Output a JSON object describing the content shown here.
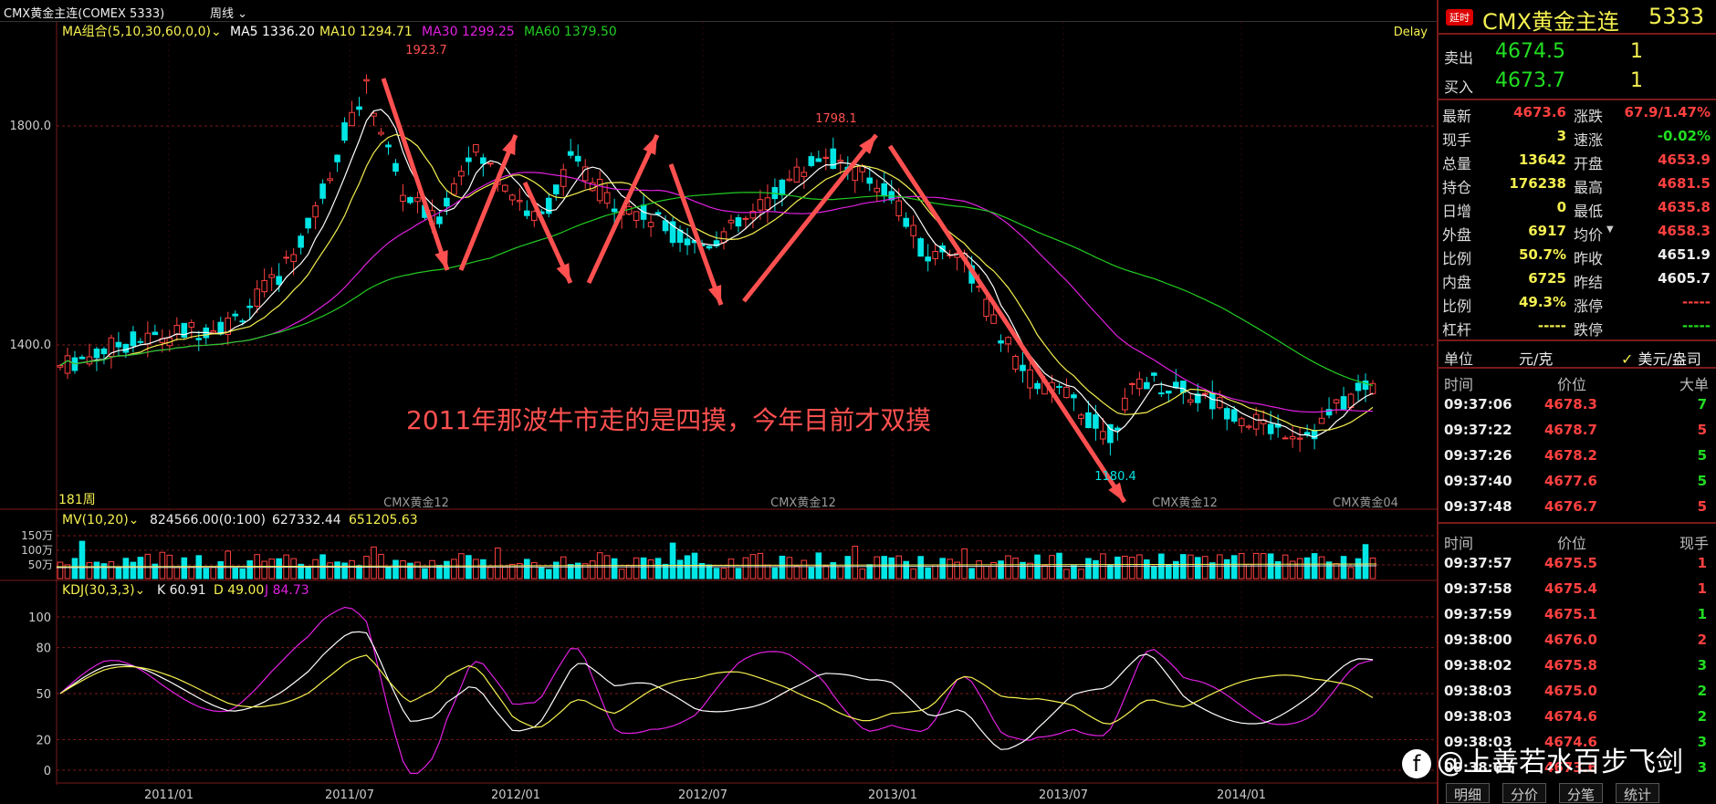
{
  "window": {
    "title": "CMX黄金主连(COMEX 5333)",
    "period": "周线"
  },
  "main_panel": {
    "ma_label": "MA组合(5,10,30,60,0,0)",
    "ma5": "MA5 1336.20",
    "ma10": "MA10 1294.71",
    "ma30": "MA30 1299.25",
    "ma60": "MA60 1379.50",
    "delay": "Delay",
    "bars": "181周",
    "y_ticks": [
      "1800.0",
      "1400.0"
    ],
    "contract_marks": [
      "CMX黄金12",
      "CMX黄金12",
      "CMX黄金12",
      "CMX黄金04"
    ],
    "high_label": "1923.7",
    "high2_label": "1798.1",
    "low_label": "1180.4",
    "annotation": "2011年那波牛市走的是四摸，今年目前才双摸"
  },
  "vol_panel": {
    "label": "MV(10,20)",
    "v1": "824566.00(0:100)",
    "v2": "627332.44",
    "v3": "651205.63",
    "y_ticks": [
      "150万",
      "100万",
      "50万"
    ]
  },
  "kdj_panel": {
    "label": "KDJ(30,3,3)",
    "k": "K 60.91",
    "d": "D 49.00",
    "j": "J 84.73",
    "y_ticks": [
      "100",
      "80",
      "50",
      "20",
      "0"
    ]
  },
  "x_axis": [
    "2011/01",
    "2011/07",
    "2012/01",
    "2012/07",
    "2013/01",
    "2013/07",
    "2014/01"
  ],
  "quote": {
    "badge": "延时",
    "name": "CMX黄金主连",
    "code": "5333",
    "sell_label": "卖出",
    "sell_price": "4674.5",
    "sell_qty": "1",
    "buy_label": "买入",
    "buy_price": "4673.7",
    "buy_qty": "1",
    "fields": [
      {
        "l1": "最新",
        "v1": "4673.6",
        "c1": "red",
        "l2": "涨跌",
        "v2": "67.9/1.47%",
        "c2": "red"
      },
      {
        "l1": "现手",
        "v1": "3",
        "c1": "yel",
        "l2": "速涨",
        "v2": "-0.02%",
        "c2": "grn"
      },
      {
        "l1": "总量",
        "v1": "13642",
        "c1": "yel",
        "l2": "开盘",
        "v2": "4653.9",
        "c2": "red"
      },
      {
        "l1": "持仓",
        "v1": "176238",
        "c1": "yel",
        "l2": "最高",
        "v2": "4681.5",
        "c2": "red"
      },
      {
        "l1": "日增",
        "v1": "0",
        "c1": "yel",
        "l2": "最低",
        "v2": "4635.8",
        "c2": "red"
      },
      {
        "l1": "外盘",
        "v1": "6917",
        "c1": "yel",
        "l2": "均价",
        "v2": "4658.3",
        "c2": "red"
      },
      {
        "l1": "比例",
        "v1": "50.7%",
        "c1": "yel",
        "l2": "昨收",
        "v2": "4651.9",
        "c2": "wht"
      },
      {
        "l1": "内盘",
        "v1": "6725",
        "c1": "yel",
        "l2": "昨结",
        "v2": "4605.7",
        "c2": "wht"
      },
      {
        "l1": "比例",
        "v1": "49.3%",
        "c1": "yel",
        "l2": "涨停",
        "v2": "-----",
        "c2": "red"
      },
      {
        "l1": "杠杆",
        "v1": "-----",
        "c1": "yel",
        "l2": "跌停",
        "v2": "-----",
        "c2": "grn"
      }
    ],
    "unit_label": "单位",
    "unit_value": "元/克",
    "unit_alt": "美元/盎司",
    "big_header": [
      "时间",
      "价位",
      "大单"
    ],
    "big_rows": [
      {
        "t": "09:37:06",
        "p": "4678.3",
        "q": "7",
        "qc": "grn"
      },
      {
        "t": "09:37:22",
        "p": "4678.7",
        "q": "5",
        "qc": "red"
      },
      {
        "t": "09:37:26",
        "p": "4678.2",
        "q": "5",
        "qc": "grn"
      },
      {
        "t": "09:37:40",
        "p": "4677.6",
        "q": "5",
        "qc": "grn"
      },
      {
        "t": "09:37:48",
        "p": "4676.7",
        "q": "5",
        "qc": "red"
      }
    ],
    "tick_header": [
      "时间",
      "价位",
      "现手"
    ],
    "tick_rows": [
      {
        "t": "09:37:57",
        "p": "4675.5",
        "q": "1",
        "qc": "red"
      },
      {
        "t": "09:37:58",
        "p": "4675.4",
        "q": "1",
        "qc": "red"
      },
      {
        "t": "09:37:59",
        "p": "4675.1",
        "q": "1",
        "qc": "grn"
      },
      {
        "t": "09:38:00",
        "p": "4676.0",
        "q": "2",
        "qc": "red"
      },
      {
        "t": "09:38:02",
        "p": "4675.8",
        "q": "3",
        "qc": "grn"
      },
      {
        "t": "09:38:03",
        "p": "4675.0",
        "q": "2",
        "qc": "grn"
      },
      {
        "t": "09:38:03",
        "p": "4674.6",
        "q": "2",
        "qc": "grn"
      },
      {
        "t": "09:38:03",
        "p": "4674.6",
        "q": "3",
        "qc": "grn"
      },
      {
        "t": "09:38:03",
        "p": "4673.6",
        "q": "3",
        "qc": "grn"
      }
    ],
    "tabs": [
      "明细",
      "分价",
      "分笔",
      "统计"
    ]
  },
  "watermark": "@上善若水百步飞剑",
  "colors": {
    "up": "#ff4040",
    "down": "#00e5e5",
    "ma5": "#ffffff",
    "ma10": "#f5f050",
    "ma30": "#e020e0",
    "ma60": "#22cc22",
    "arrow": "#ff5050"
  }
}
